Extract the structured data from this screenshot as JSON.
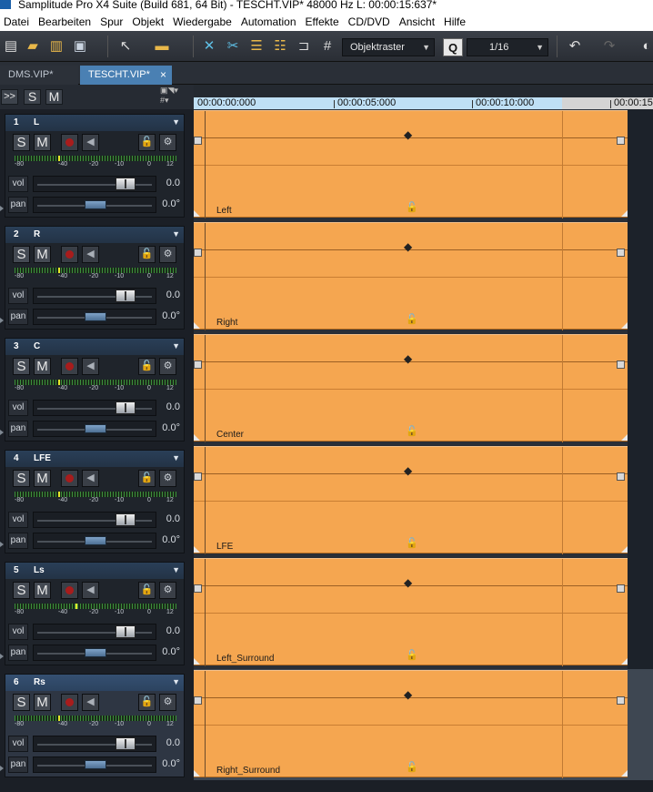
{
  "window": {
    "title": "Samplitude Pro X4 Suite (Build 681, 64 Bit)  -  TESCHT.VIP*   48000 Hz L: 00:00:15:637*"
  },
  "menu": [
    "Datei",
    "Bearbeiten",
    "Spur",
    "Objekt",
    "Wiedergabe",
    "Automation",
    "Effekte",
    "CD/DVD",
    "Ansicht",
    "Hilfe"
  ],
  "toolbar": {
    "snap_mode": "Objektraster",
    "quantize_label": "Q",
    "quantize_value": "1/16",
    "icons": [
      "new-file-icon",
      "open-folder-icon",
      "import-icon",
      "save-icon",
      "pointer-tool-icon",
      "range-tool-icon",
      "crossfade-icon",
      "split-icon",
      "align-left-icon",
      "align-right-icon",
      "snap-magnet-icon",
      "grid-icon",
      "undo-icon",
      "redo-icon"
    ]
  },
  "tabs": [
    {
      "label": "DMS.VIP*",
      "active": false
    },
    {
      "label": "TESCHT.VIP*",
      "active": true,
      "close": "×"
    }
  ],
  "header_buttons": {
    "expand": ">>",
    "solo": "S",
    "mute": "M"
  },
  "ruler": {
    "labels": [
      "00:00:00:000",
      "00:00:05:000",
      "00:00:10:000",
      "00:00:15"
    ]
  },
  "tracks": [
    {
      "number": "1",
      "name": "L",
      "vol_label": "vol",
      "vol_value": "0.0",
      "pan_label": "pan",
      "pan_value": "0.0°",
      "clip_name": "Left",
      "selected": false
    },
    {
      "number": "2",
      "name": "R",
      "vol_label": "vol",
      "vol_value": "0.0",
      "pan_label": "pan",
      "pan_value": "0.0°",
      "clip_name": "Right",
      "selected": false
    },
    {
      "number": "3",
      "name": "C",
      "vol_label": "vol",
      "vol_value": "0.0",
      "pan_label": "pan",
      "pan_value": "0.0°",
      "clip_name": "Center",
      "selected": false
    },
    {
      "number": "4",
      "name": "LFE",
      "vol_label": "vol",
      "vol_value": "0.0",
      "pan_label": "pan",
      "pan_value": "0.0°",
      "clip_name": "LFE",
      "selected": false
    },
    {
      "number": "5",
      "name": "Ls",
      "vol_label": "vol",
      "vol_value": "0.0",
      "pan_label": "pan",
      "pan_value": "0.0°",
      "clip_name": "Left_Surround",
      "selected": false
    },
    {
      "number": "6",
      "name": "Rs",
      "vol_label": "vol",
      "vol_value": "0.0",
      "pan_label": "pan",
      "pan_value": "0.0°",
      "clip_name": "Right_Surround",
      "selected": true
    }
  ],
  "meter_scale": [
    "-80",
    "-40",
    "-20",
    "-10",
    "0",
    "12"
  ],
  "colors": {
    "clip": "#f5a650",
    "accent": "#4a80b3",
    "track_header": "#233346"
  }
}
